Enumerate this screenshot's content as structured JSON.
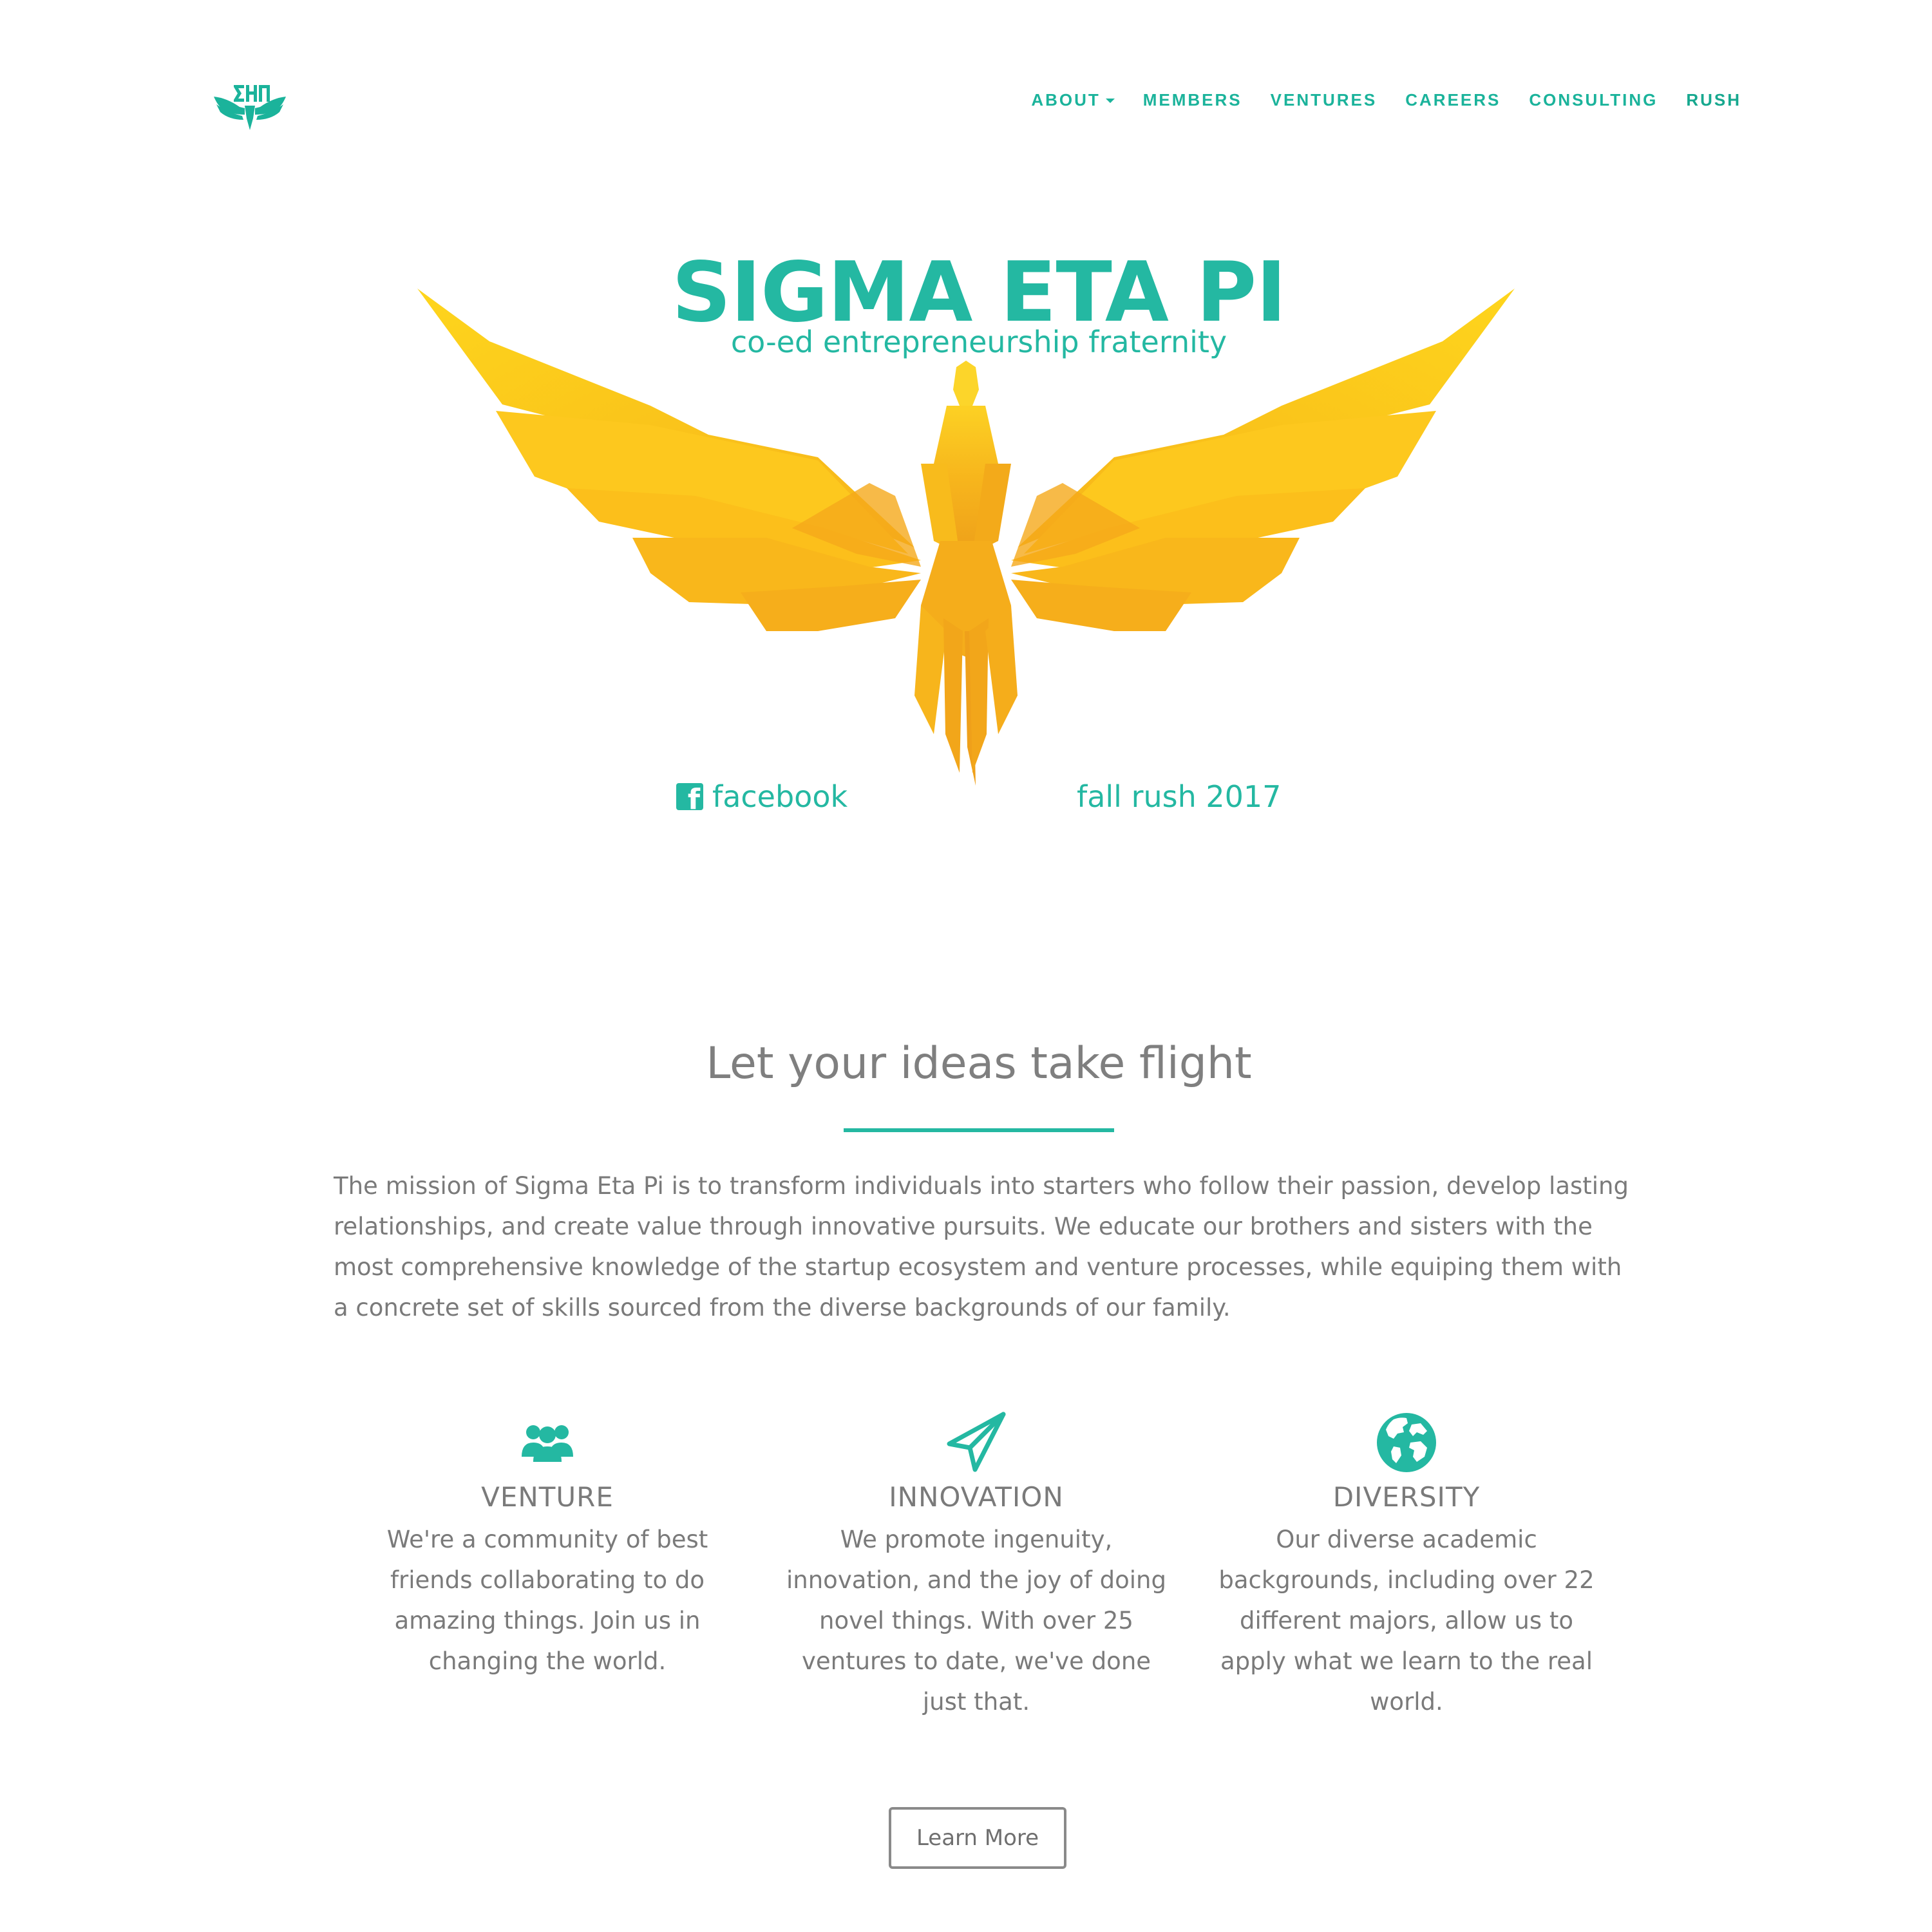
{
  "brand": {
    "logo_text": "ΣΗΠ",
    "logo_icon": "eagle-logo-icon"
  },
  "nav": {
    "items": [
      {
        "label": "ABOUT",
        "has_caret": true
      },
      {
        "label": "MEMBERS"
      },
      {
        "label": "VENTURES"
      },
      {
        "label": "CAREERS"
      },
      {
        "label": "CONSULTING"
      },
      {
        "label": "RUSH",
        "emphasized": true
      }
    ]
  },
  "hero": {
    "title": "SIGMA ETA PI",
    "subtitle": "co-ed entrepreneurship fraternity",
    "facebook_label": "facebook",
    "rush_label": "fall rush 2017",
    "image": "yellow-origami-eagle"
  },
  "about": {
    "heading": "Let your ideas take flight",
    "mission": "The mission of Sigma Eta Pi is to transform individuals into starters who follow their passion, develop lasting relationships, and create value through innovative pursuits. We educate our brothers and sisters with the most comprehensive knowledge of the startup ecosystem and venture processes, while equiping them with a concrete set of skills sourced from the diverse backgrounds of our family."
  },
  "features": [
    {
      "icon": "people-group-icon",
      "title": "VENTURE",
      "text": "We're a community of best friends collaborating to do amazing things. Join us in changing the world."
    },
    {
      "icon": "paper-plane-icon",
      "title": "INNOVATION",
      "text": "We promote ingenuity, innovation, and the joy of doing novel things. With over 25 ventures to date, we've done just that."
    },
    {
      "icon": "globe-icon",
      "title": "DIVERSITY",
      "text": "Our diverse academic backgrounds, including over 22 different majors, allow us to apply what we learn to the real world."
    }
  ],
  "cta": {
    "learn_more": "Learn More"
  },
  "colors": {
    "accent": "#24b8a2",
    "text_gray": "#7a7a7a",
    "eagle_yellow": "#fcc419",
    "eagle_orange": "#f2a21c"
  }
}
